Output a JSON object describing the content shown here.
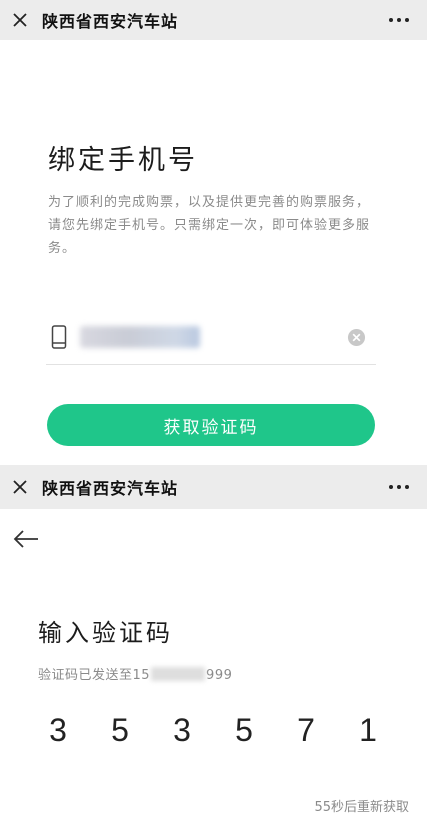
{
  "step1": {
    "titlebar": {
      "title": "陕西省西安汽车站",
      "close_icon": "close-icon",
      "more_icon": "more-icon"
    },
    "heading": "绑定手机号",
    "description": "为了顺利的完成购票，以及提供更完善的购票服务，请您先绑定手机号。只需绑定一次，即可体验更多服务。",
    "phone_input": {
      "icon": "phone-icon",
      "value": "",
      "clear_icon": "clear-icon"
    },
    "button_label": "获取验证码",
    "accent_color": "#1fc68a"
  },
  "step2": {
    "titlebar": {
      "title": "陕西省西安汽车站",
      "close_icon": "close-icon",
      "more_icon": "more-icon"
    },
    "back_icon": "back-arrow-icon",
    "heading": "输入验证码",
    "sent_prefix": "验证码已发送至15",
    "sent_suffix": "999",
    "code_digits": [
      "3",
      "5",
      "3",
      "5",
      "7",
      "1"
    ],
    "resend_text": "55秒后重新获取"
  }
}
